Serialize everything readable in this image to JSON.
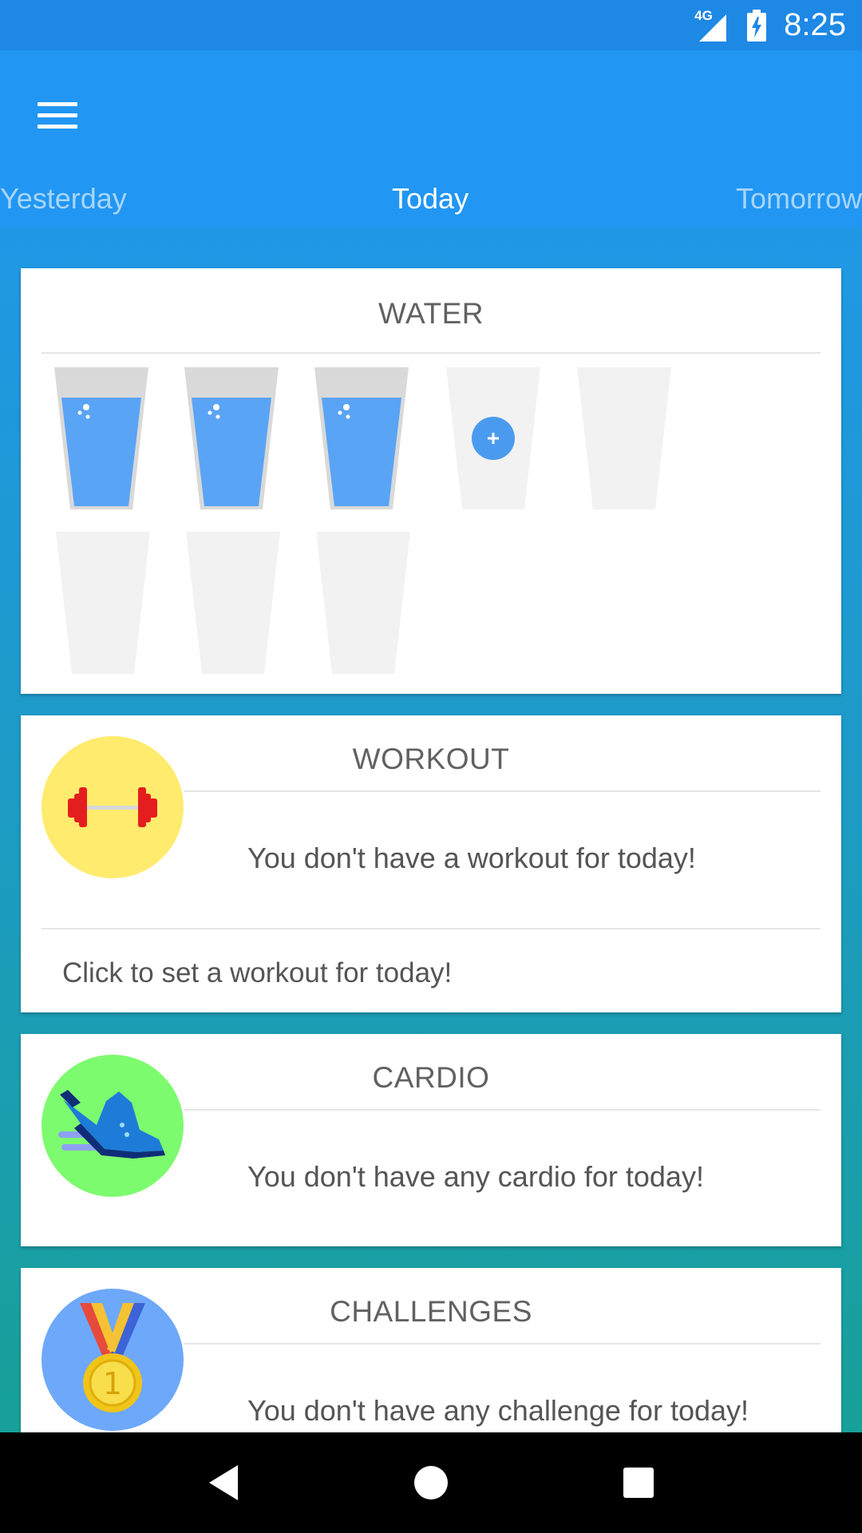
{
  "status_bar": {
    "network": "4G",
    "time": "8:25"
  },
  "app_bar": {
    "menu_icon": "hamburger-menu-icon",
    "tabs": [
      {
        "label": "Yesterday",
        "active": false
      },
      {
        "label": "Today",
        "active": true
      },
      {
        "label": "Tomorrow",
        "active": false
      }
    ]
  },
  "water": {
    "title": "WATER",
    "glasses_total": 8,
    "glasses_filled": 3,
    "add_icon": "plus-icon",
    "colors": {
      "water": "#5AA4F5",
      "empty_glass": "#F2F2F2",
      "add_button": "#4A9BEF"
    }
  },
  "workout": {
    "title": "WORKOUT",
    "message": "You don't have a workout for today!",
    "action": "Click to set a workout for today!",
    "icon": "dumbbell-icon",
    "icon_bg": "#FFEB6E"
  },
  "cardio": {
    "title": "CARDIO",
    "message": "You don't have any cardio for today!",
    "icon": "running-shoe-icon",
    "icon_bg": "#7DFB6E"
  },
  "challenges": {
    "title": "CHALLENGES",
    "message": "You don't have any challenge for today!",
    "icon": "medal-icon",
    "medal_number": "1",
    "icon_bg": "#6EA8FB"
  },
  "nav_bar": {
    "back_icon": "back-triangle-icon",
    "home_icon": "home-circle-icon",
    "recents_icon": "recents-square-icon"
  }
}
